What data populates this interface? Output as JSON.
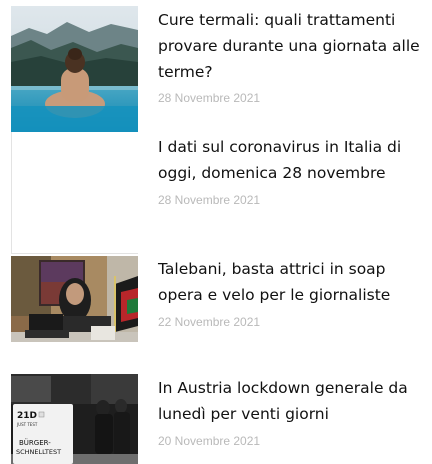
{
  "articles": [
    {
      "title": "Cure termali: quali trattamenti provare durante una giornata alle terme?",
      "date": "28 Novembre 2021",
      "image": "woman-in-thermal-pool"
    },
    {
      "title": "I dati sul coronavirus in Italia di oggi, domenica 28 novembre",
      "date": "28 Novembre 2021",
      "image": "blank-thumbnail"
    },
    {
      "title": "Talebani, basta attrici in soap opera e velo per le giornaliste",
      "date": "22 Novembre 2021",
      "image": "woman-at-desk-with-afghan-flag"
    },
    {
      "title": "In Austria lockdown generale  da lunedì per venti giorni",
      "date": "20 Novembre 2021",
      "image": "test-center-sign",
      "sign": {
        "code": "21D",
        "sub": "JUST TEST",
        "line1": "BÜRGER-",
        "line2": "SCHNELLTEST"
      }
    }
  ]
}
